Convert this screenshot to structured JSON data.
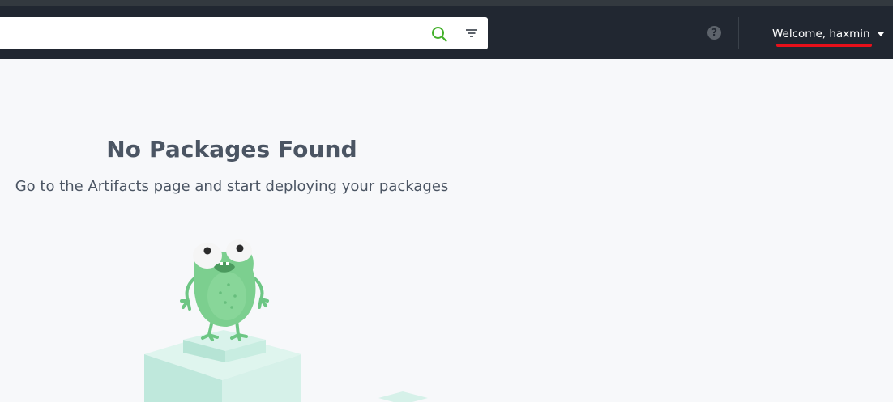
{
  "header": {
    "search": {
      "value": "",
      "placeholder": ""
    },
    "search_icon": "search-icon",
    "filter_icon": "filter-icon",
    "help_icon": {
      "name": "help-icon",
      "glyph": "?"
    },
    "user": {
      "welcome_text": "Welcome, haxmin",
      "caret_icon": "caret-down-icon"
    }
  },
  "empty_state": {
    "title": "No Packages Found",
    "subtitle": "Go to the Artifacts page and start deploying your packages",
    "illustration": "frog-on-cubes"
  },
  "colors": {
    "topbar_bg": "#212731",
    "page_bg": "#f7f8fa",
    "search_icon": "#43b02a",
    "annotation_underline": "#e8101a",
    "text_heading": "#4b5563",
    "frog": "#7ccf8f",
    "cube": "#cdece3"
  }
}
